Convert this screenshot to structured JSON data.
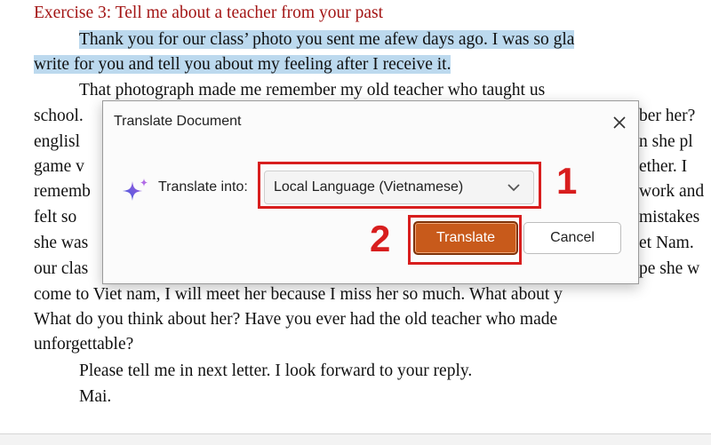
{
  "document": {
    "heading": "Exercise 3: Tell me about a teacher from your past",
    "lines": [
      "Thank you for our class’ photo you sent me afew days ago. I was so gla",
      "write for you and tell you about my feeling after I receive it.",
      "That photograph made me remember my old teacher who taught us",
      "school.",
      "englisl",
      "game v",
      "rememb",
      "felt so",
      "she was",
      "our clas",
      "come to Viet nam, I will meet her because I miss her so much. What about y",
      "What do you think about her? Have you ever had the old teacher who made",
      "unforgettable?",
      "Please tell me in next letter. I look forward to your reply.",
      "Mai."
    ],
    "right_fragments": [
      "ber her?",
      "n she pl",
      "ether. I",
      "work and",
      "mistakes",
      "et Nam.",
      "pe she w"
    ]
  },
  "dialog": {
    "title": "Translate Document",
    "translate_label": "Translate into:",
    "language_selected": "Local Language (Vietnamese)",
    "translate_button": "Translate",
    "cancel_button": "Cancel",
    "icons": {
      "sparkle": "sparkle-icon",
      "close": "close-icon",
      "dropdown": "chevron-down-icon"
    }
  },
  "annotations": {
    "step1": "1",
    "step2": "2",
    "color": "#d81e1e"
  },
  "colors": {
    "heading": "#a31515",
    "highlight": "#bcd9ee",
    "translate_button": "#c85a1b"
  }
}
